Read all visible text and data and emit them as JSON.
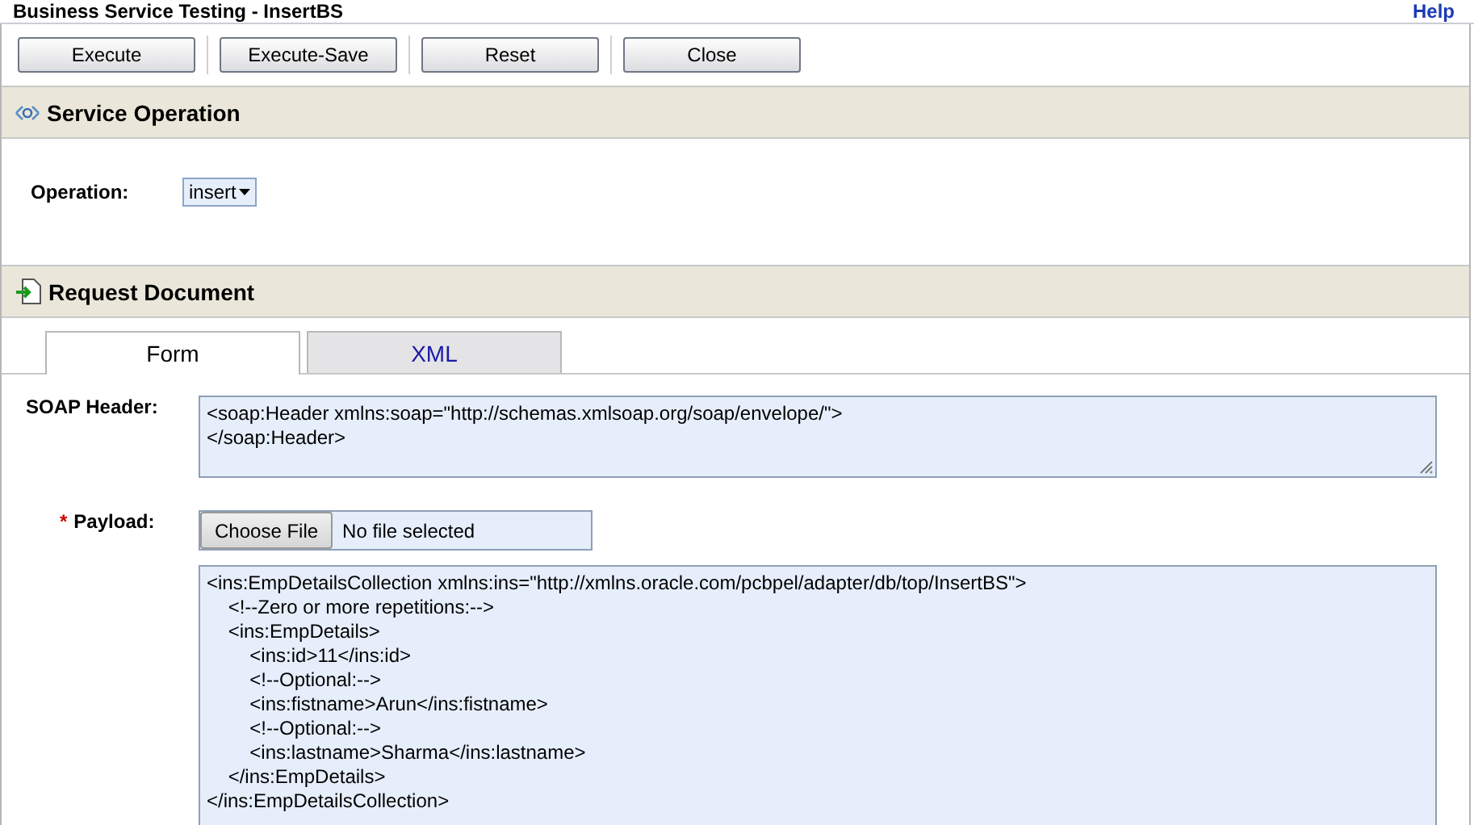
{
  "window": {
    "title": "Business Service Testing - InsertBS",
    "help": "Help"
  },
  "toolbar": {
    "buttons": [
      {
        "label": "Execute"
      },
      {
        "label": "Execute-Save"
      },
      {
        "label": "Reset"
      },
      {
        "label": "Close"
      }
    ]
  },
  "service_operation": {
    "title": "Service Operation",
    "operation_label": "Operation:",
    "operation_value": "insert"
  },
  "request_document": {
    "title": "Request Document",
    "tabs": [
      {
        "label": "Form",
        "selected": true
      },
      {
        "label": "XML",
        "selected": false
      }
    ],
    "soap_header": {
      "label": "SOAP Header:",
      "value": "<soap:Header xmlns:soap=\"http://schemas.xmlsoap.org/soap/envelope/\">\n</soap:Header>"
    },
    "payload": {
      "label": "Payload:",
      "required_marker": "*",
      "file_button": "Choose File",
      "file_status": "No file selected",
      "value": "<ins:EmpDetailsCollection xmlns:ins=\"http://xmlns.oracle.com/pcbpel/adapter/db/top/InsertBS\">\n    <!--Zero or more repetitions:-->\n    <ins:EmpDetails>\n        <ins:id>11</ins:id>\n        <!--Optional:-->\n        <ins:fistname>Arun</ins:fistname>\n        <!--Optional:-->\n        <ins:lastname>Sharma</ins:lastname>\n    </ins:EmpDetails>\n</ins:EmpDetailsCollection>"
    }
  }
}
